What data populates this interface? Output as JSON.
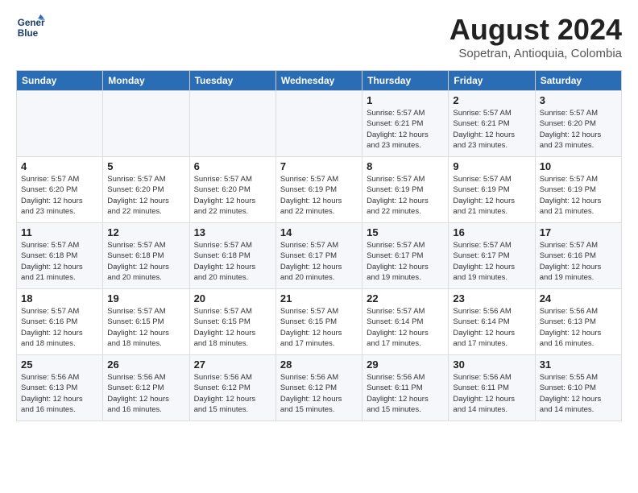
{
  "header": {
    "logo_line1": "General",
    "logo_line2": "Blue",
    "title": "August 2024",
    "subtitle": "Sopetran, Antioquia, Colombia"
  },
  "weekdays": [
    "Sunday",
    "Monday",
    "Tuesday",
    "Wednesday",
    "Thursday",
    "Friday",
    "Saturday"
  ],
  "weeks": [
    [
      {
        "day": "",
        "info": ""
      },
      {
        "day": "",
        "info": ""
      },
      {
        "day": "",
        "info": ""
      },
      {
        "day": "",
        "info": ""
      },
      {
        "day": "1",
        "info": "Sunrise: 5:57 AM\nSunset: 6:21 PM\nDaylight: 12 hours\nand 23 minutes."
      },
      {
        "day": "2",
        "info": "Sunrise: 5:57 AM\nSunset: 6:21 PM\nDaylight: 12 hours\nand 23 minutes."
      },
      {
        "day": "3",
        "info": "Sunrise: 5:57 AM\nSunset: 6:20 PM\nDaylight: 12 hours\nand 23 minutes."
      }
    ],
    [
      {
        "day": "4",
        "info": "Sunrise: 5:57 AM\nSunset: 6:20 PM\nDaylight: 12 hours\nand 23 minutes."
      },
      {
        "day": "5",
        "info": "Sunrise: 5:57 AM\nSunset: 6:20 PM\nDaylight: 12 hours\nand 22 minutes."
      },
      {
        "day": "6",
        "info": "Sunrise: 5:57 AM\nSunset: 6:20 PM\nDaylight: 12 hours\nand 22 minutes."
      },
      {
        "day": "7",
        "info": "Sunrise: 5:57 AM\nSunset: 6:19 PM\nDaylight: 12 hours\nand 22 minutes."
      },
      {
        "day": "8",
        "info": "Sunrise: 5:57 AM\nSunset: 6:19 PM\nDaylight: 12 hours\nand 22 minutes."
      },
      {
        "day": "9",
        "info": "Sunrise: 5:57 AM\nSunset: 6:19 PM\nDaylight: 12 hours\nand 21 minutes."
      },
      {
        "day": "10",
        "info": "Sunrise: 5:57 AM\nSunset: 6:19 PM\nDaylight: 12 hours\nand 21 minutes."
      }
    ],
    [
      {
        "day": "11",
        "info": "Sunrise: 5:57 AM\nSunset: 6:18 PM\nDaylight: 12 hours\nand 21 minutes."
      },
      {
        "day": "12",
        "info": "Sunrise: 5:57 AM\nSunset: 6:18 PM\nDaylight: 12 hours\nand 20 minutes."
      },
      {
        "day": "13",
        "info": "Sunrise: 5:57 AM\nSunset: 6:18 PM\nDaylight: 12 hours\nand 20 minutes."
      },
      {
        "day": "14",
        "info": "Sunrise: 5:57 AM\nSunset: 6:17 PM\nDaylight: 12 hours\nand 20 minutes."
      },
      {
        "day": "15",
        "info": "Sunrise: 5:57 AM\nSunset: 6:17 PM\nDaylight: 12 hours\nand 19 minutes."
      },
      {
        "day": "16",
        "info": "Sunrise: 5:57 AM\nSunset: 6:17 PM\nDaylight: 12 hours\nand 19 minutes."
      },
      {
        "day": "17",
        "info": "Sunrise: 5:57 AM\nSunset: 6:16 PM\nDaylight: 12 hours\nand 19 minutes."
      }
    ],
    [
      {
        "day": "18",
        "info": "Sunrise: 5:57 AM\nSunset: 6:16 PM\nDaylight: 12 hours\nand 18 minutes."
      },
      {
        "day": "19",
        "info": "Sunrise: 5:57 AM\nSunset: 6:15 PM\nDaylight: 12 hours\nand 18 minutes."
      },
      {
        "day": "20",
        "info": "Sunrise: 5:57 AM\nSunset: 6:15 PM\nDaylight: 12 hours\nand 18 minutes."
      },
      {
        "day": "21",
        "info": "Sunrise: 5:57 AM\nSunset: 6:15 PM\nDaylight: 12 hours\nand 17 minutes."
      },
      {
        "day": "22",
        "info": "Sunrise: 5:57 AM\nSunset: 6:14 PM\nDaylight: 12 hours\nand 17 minutes."
      },
      {
        "day": "23",
        "info": "Sunrise: 5:56 AM\nSunset: 6:14 PM\nDaylight: 12 hours\nand 17 minutes."
      },
      {
        "day": "24",
        "info": "Sunrise: 5:56 AM\nSunset: 6:13 PM\nDaylight: 12 hours\nand 16 minutes."
      }
    ],
    [
      {
        "day": "25",
        "info": "Sunrise: 5:56 AM\nSunset: 6:13 PM\nDaylight: 12 hours\nand 16 minutes."
      },
      {
        "day": "26",
        "info": "Sunrise: 5:56 AM\nSunset: 6:12 PM\nDaylight: 12 hours\nand 16 minutes."
      },
      {
        "day": "27",
        "info": "Sunrise: 5:56 AM\nSunset: 6:12 PM\nDaylight: 12 hours\nand 15 minutes."
      },
      {
        "day": "28",
        "info": "Sunrise: 5:56 AM\nSunset: 6:12 PM\nDaylight: 12 hours\nand 15 minutes."
      },
      {
        "day": "29",
        "info": "Sunrise: 5:56 AM\nSunset: 6:11 PM\nDaylight: 12 hours\nand 15 minutes."
      },
      {
        "day": "30",
        "info": "Sunrise: 5:56 AM\nSunset: 6:11 PM\nDaylight: 12 hours\nand 14 minutes."
      },
      {
        "day": "31",
        "info": "Sunrise: 5:55 AM\nSunset: 6:10 PM\nDaylight: 12 hours\nand 14 minutes."
      }
    ]
  ]
}
